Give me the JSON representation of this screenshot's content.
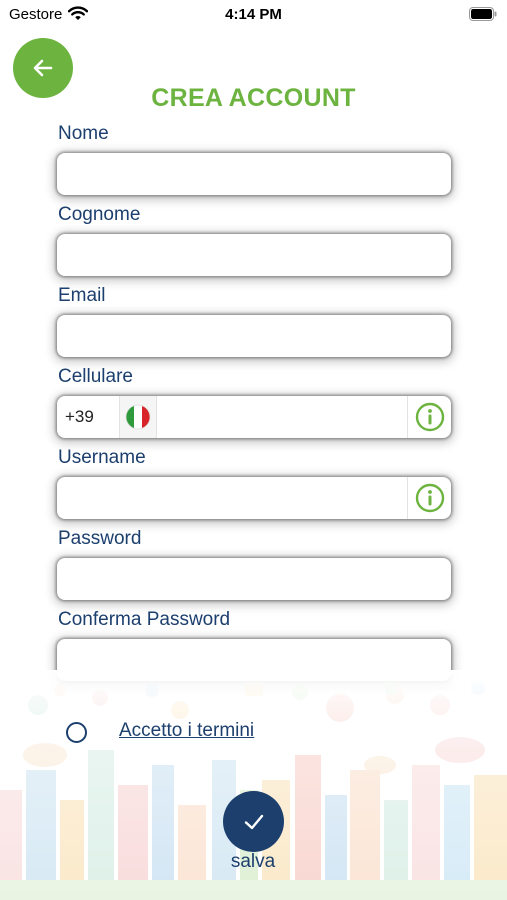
{
  "status_bar": {
    "carrier": "Gestore",
    "time": "4:14 PM"
  },
  "page": {
    "title": "CREA ACCOUNT"
  },
  "form": {
    "nome": {
      "label": "Nome",
      "value": ""
    },
    "cognome": {
      "label": "Cognome",
      "value": ""
    },
    "email": {
      "label": "Email",
      "value": ""
    },
    "cellulare": {
      "label": "Cellulare",
      "prefix": "+39",
      "value": ""
    },
    "username": {
      "label": "Username",
      "value": ""
    },
    "password": {
      "label": "Password",
      "value": ""
    },
    "conferma_password": {
      "label": "Conferma Password",
      "value": ""
    }
  },
  "terms": {
    "label": "Accetto i termini",
    "checked": false
  },
  "actions": {
    "save_label": "salva"
  },
  "colors": {
    "accent": "#6cb43f",
    "primary": "#1c3f6e"
  },
  "icons": [
    "back-arrow-icon",
    "wifi-icon",
    "battery-icon",
    "italy-flag-icon",
    "info-icon",
    "checkmark-icon"
  ]
}
